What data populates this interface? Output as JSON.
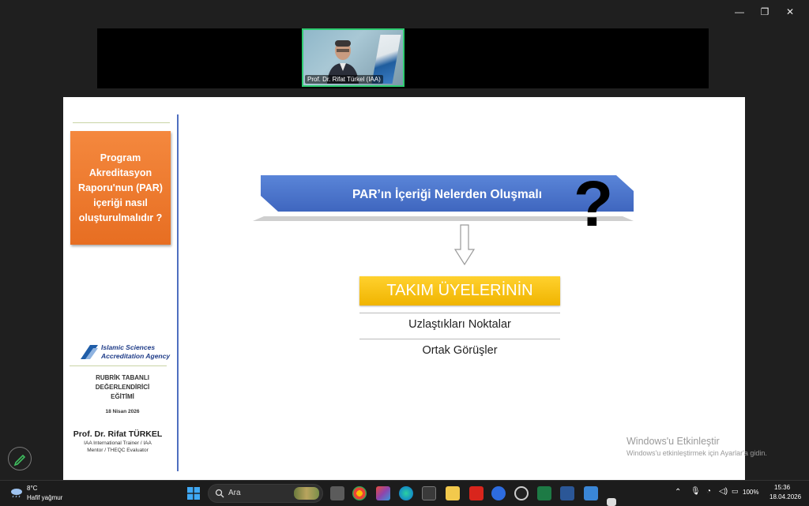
{
  "window_controls": {
    "minimize": "—",
    "restore": "❐",
    "close": "✕"
  },
  "video": {
    "participant_name": "Prof. Dr. Rifat Türkel (IAA)"
  },
  "slide": {
    "orange_box_text": "Program Akreditasyon Raporu'nun (PAR) içeriği nasıl oluşturulmalıdır ?",
    "logo_line1": "Islamic Sciences",
    "logo_line2": "Accreditation Agency",
    "rubrik_lines": [
      "RUBRİK TABANLI",
      "DEĞERLENDİRİCİ",
      "EĞİTİMİ"
    ],
    "date": "18 Nisan 2026",
    "presenter": "Prof. Dr. Rifat TÜRKEL",
    "roles": [
      "IAA International Trainer / IAA",
      "Mentor / THEQC Evaluator"
    ],
    "banner_title": "PAR’ın İçeriği Nelerden Oluşmalı",
    "question_mark": "?",
    "yellow_box": "TAKIM ÜYELERİNİN",
    "items": [
      "Uzlaştıkları Noktalar",
      "Ortak Görüşler"
    ]
  },
  "watermark": {
    "line1": "Windows'u Etkinleştir",
    "line2": "Windows'u etkinleştirmek için Ayarlar'a gidin."
  },
  "taskbar": {
    "weather_temp": "8°C",
    "weather_desc": "Hafif yağmur",
    "search_placeholder": "Ara",
    "battery": "100%",
    "time": "15:36",
    "date": "18.04.2026"
  },
  "colors": {
    "orange": "#f07a2e",
    "banner_blue": "#4a72c9",
    "yellow": "#f5bf10",
    "sidebar_line": "#4f6fc0"
  }
}
